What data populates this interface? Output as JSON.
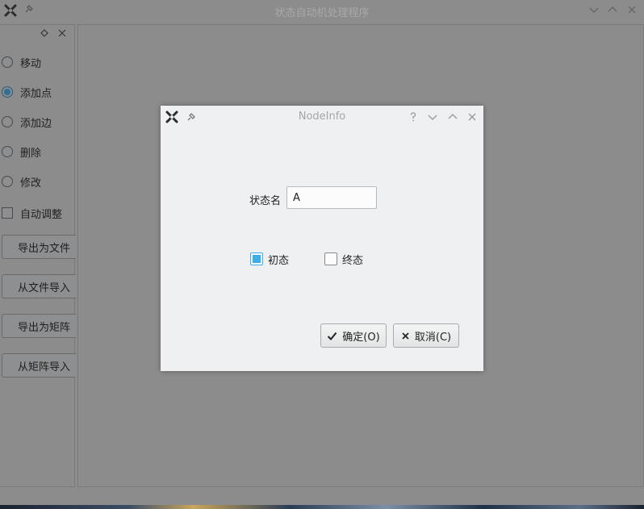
{
  "main_window": {
    "title": "状态自动机处理程序"
  },
  "sidebar": {
    "tools": [
      {
        "label": "移动",
        "checked": false
      },
      {
        "label": "添加点",
        "checked": true
      },
      {
        "label": "添加边",
        "checked": false
      },
      {
        "label": "删除",
        "checked": false
      },
      {
        "label": "修改",
        "checked": false
      }
    ],
    "auto_adjust": {
      "label": "自动调整",
      "checked": false
    },
    "buttons": [
      "导出为文件",
      "从文件导入",
      "导出为矩阵",
      "从矩阵导入"
    ]
  },
  "dialog": {
    "title": "NodeInfo",
    "state_name_label": "状态名",
    "state_name_value": "A",
    "initial_label": "初态",
    "initial_checked": true,
    "final_label": "终态",
    "final_checked": false,
    "ok_label": "确定(O)",
    "cancel_label": "取消(C)"
  },
  "colors": {
    "accent": "#3daee9",
    "dim_bg": "#8c8c8d",
    "dialog_bg": "#eff0f1"
  }
}
